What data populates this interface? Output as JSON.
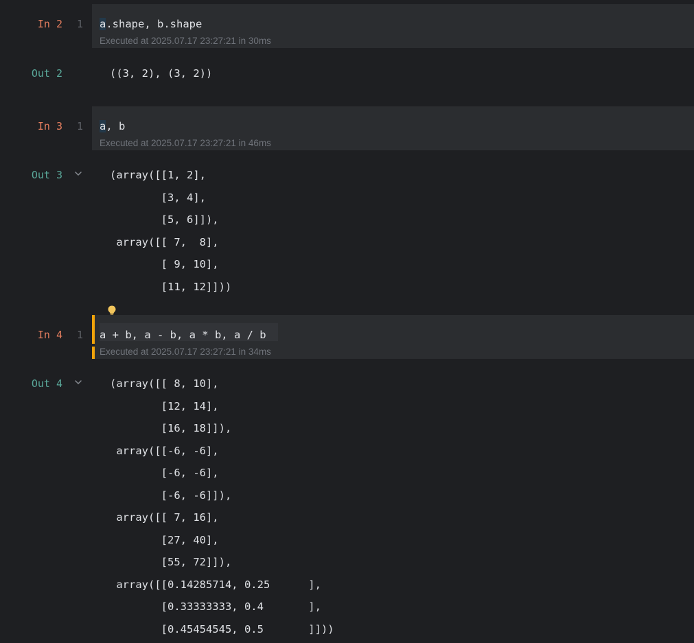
{
  "colors": {
    "background": "#1e1f22",
    "cell_background": "#2b2d30",
    "in_label": "#e57e5f",
    "out_label": "#5aa89a",
    "active_marker": "#f0a30a",
    "bulb": "#f2c55c"
  },
  "cells": [
    {
      "in_label": "In 2",
      "line_number": "1",
      "code_first": "a",
      "code_rest": ".shape, b.shape",
      "exec_info": "Executed at 2025.07.17 23:27:21 in 30ms",
      "out_label": "Out 2",
      "output": "((3, 2), (3, 2))"
    },
    {
      "in_label": "In 3",
      "line_number": "1",
      "code_first": "a",
      "code_rest": ", b",
      "exec_info": "Executed at 2025.07.17 23:27:21 in 46ms",
      "out_label": "Out 3",
      "output": "(array([[1, 2],\n        [3, 4],\n        [5, 6]]),\n array([[ 7,  8],\n        [ 9, 10],\n        [11, 12]]))"
    },
    {
      "in_label": "In 4",
      "line_number": "1",
      "code": "a + b, a - b, a * b, a / b",
      "exec_info": "Executed at 2025.07.17 23:27:21 in 34ms",
      "out_label": "Out 4",
      "output": "(array([[ 8, 10],\n        [12, 14],\n        [16, 18]]),\n array([[-6, -6],\n        [-6, -6],\n        [-6, -6]]),\n array([[ 7, 16],\n        [27, 40],\n        [55, 72]]),\n array([[0.14285714, 0.25      ],\n        [0.33333333, 0.4       ],\n        [0.45454545, 0.5       ]]))"
    }
  ],
  "icons": {
    "collapse_output": "chevron-down-icon",
    "intention_action": "lightbulb-icon"
  }
}
